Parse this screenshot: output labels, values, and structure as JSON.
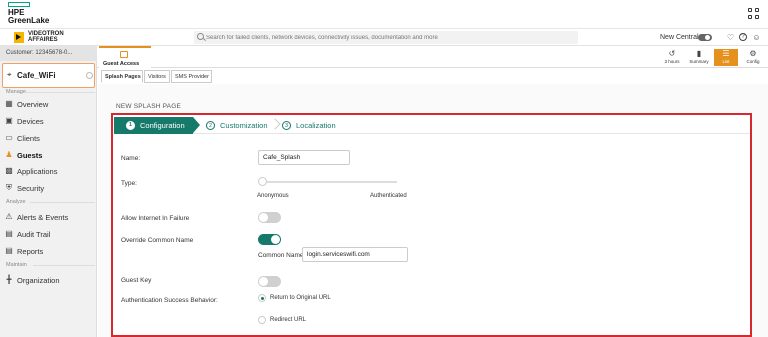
{
  "topbar": {
    "logo_line1": "HPE",
    "logo_line2": "GreenLake"
  },
  "brand": {
    "line1": "VIDEOTRON",
    "line2": "AFFAIRES"
  },
  "search": {
    "placeholder": "Search for failed clients, network devices, connectivity issues, documentation and more"
  },
  "header": {
    "new_central_label": "New Central"
  },
  "sidebar": {
    "customer": "Customer: 12345678-0...",
    "site": "Cafe_WiFi",
    "sections": {
      "manage": "Manage",
      "analyze": "Analyze",
      "maintain": "Maintain"
    },
    "items": [
      {
        "label": "Overview",
        "icon": "overview-icon"
      },
      {
        "label": "Devices",
        "icon": "devices-icon"
      },
      {
        "label": "Clients",
        "icon": "clients-icon"
      },
      {
        "label": "Guests",
        "icon": "guests-icon",
        "active": true
      },
      {
        "label": "Applications",
        "icon": "applications-icon"
      },
      {
        "label": "Security",
        "icon": "security-icon"
      },
      {
        "label": "Alerts & Events",
        "icon": "alerts-icon"
      },
      {
        "label": "Audit Trail",
        "icon": "audit-trail-icon"
      },
      {
        "label": "Reports",
        "icon": "reports-icon"
      },
      {
        "label": "Organization",
        "icon": "organization-icon"
      }
    ]
  },
  "tabs": {
    "guest_access": "Guest Access",
    "right": [
      {
        "label": "3 hours",
        "icon": "history-icon"
      },
      {
        "label": "Summary",
        "icon": "summary-icon"
      },
      {
        "label": "List",
        "icon": "list-icon",
        "active": true
      },
      {
        "label": "Config",
        "icon": "config-icon"
      }
    ]
  },
  "subtabs": [
    "Splash Pages",
    "Visitors",
    "SMS Provider"
  ],
  "form": {
    "heading": "NEW SPLASH PAGE",
    "steps": [
      {
        "num": "1",
        "label": "Configuration",
        "active": true
      },
      {
        "num": "2",
        "label": "Customization"
      },
      {
        "num": "3",
        "label": "Localization"
      }
    ],
    "name_label": "Name:",
    "name_value": "Cafe_Splash",
    "type_label": "Type:",
    "type_left": "Anonymous",
    "type_right": "Authenticated",
    "type_value": "Anonymous",
    "allow_internet_label": "Allow Internet In Failure",
    "allow_internet_on": false,
    "override_label": "Override Common Name",
    "override_on": true,
    "common_name_label": "Common Name",
    "common_name_value": "login.serviceswifi.com",
    "guest_key_label": "Guest Key",
    "guest_key_on": false,
    "auth_success_label": "Authentication Success Behavior:",
    "auth_options": [
      {
        "label": "Return to Original URL",
        "checked": true
      },
      {
        "label": "Redirect URL",
        "checked": false
      }
    ]
  },
  "colors": {
    "accent_orange": "#e6901e",
    "teal": "#167a6b",
    "frame_red": "#d6292f",
    "brand_green": "#01a982"
  }
}
